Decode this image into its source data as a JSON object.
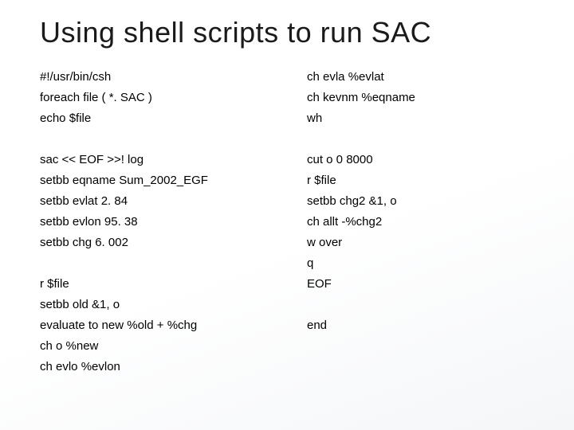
{
  "title": "Using shell scripts to run SAC",
  "left": [
    "#!/usr/bin/csh",
    "foreach file ( *. SAC )",
    "echo $file",
    "",
    "sac << EOF >>! log",
    "setbb eqname Sum_2002_EGF",
    "setbb evlat 2. 84",
    "setbb evlon 95. 38",
    "setbb chg 6. 002",
    "",
    "r $file",
    "setbb old &1, o",
    "evaluate to new %old + %chg",
    "ch o %new",
    "ch evlo %evlon"
  ],
  "right": [
    "ch evla %evlat",
    "ch kevnm %eqname",
    "wh",
    "",
    "cut o 0 8000",
    "r $file",
    "setbb chg2 &1, o",
    "ch allt -%chg2",
    "w over",
    "q",
    "EOF",
    "",
    "end",
    "",
    ""
  ]
}
